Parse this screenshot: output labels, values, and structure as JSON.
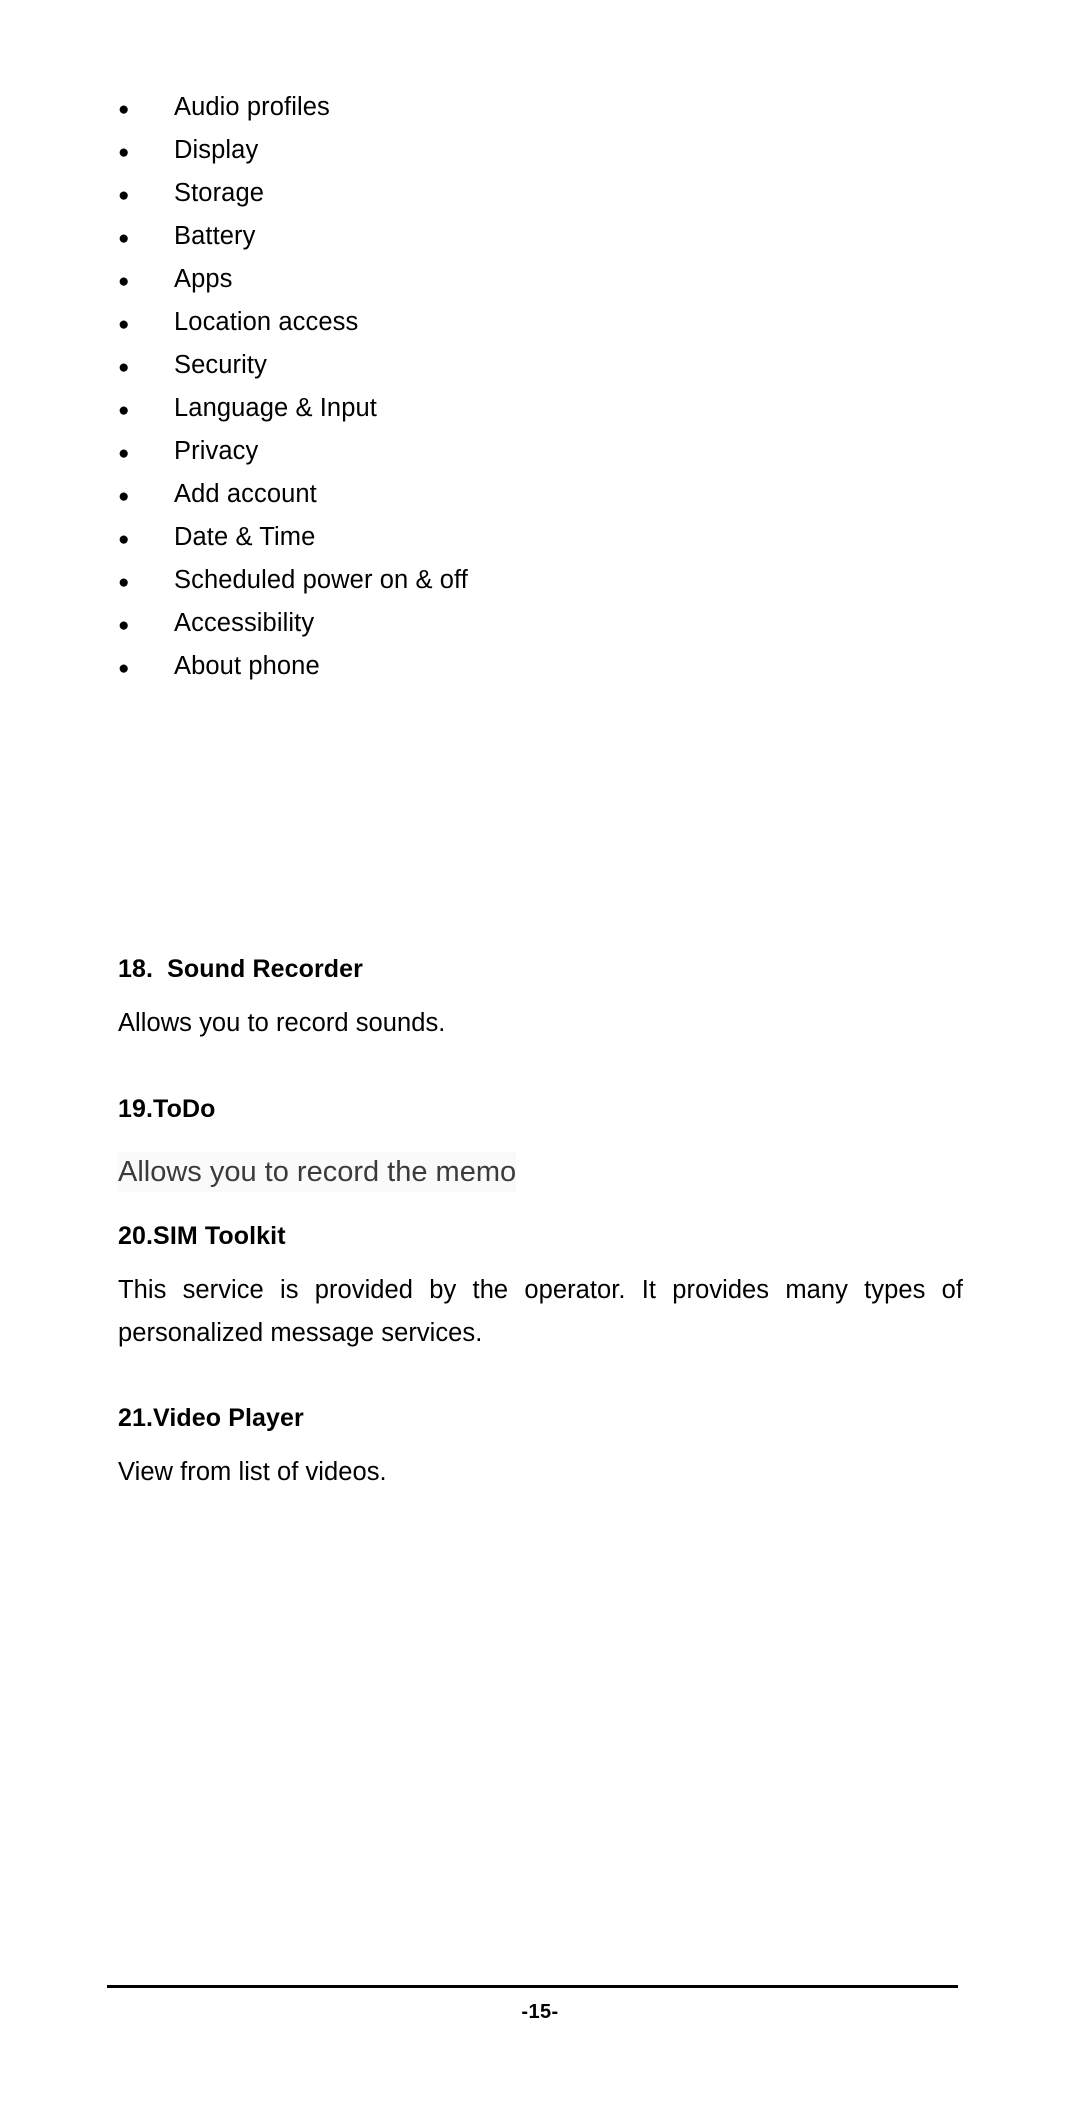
{
  "document": {
    "page_label": "-15-"
  },
  "settings_list": {
    "bullet_glyph": "●",
    "items": [
      {
        "label": "Audio profiles"
      },
      {
        "label": "Display"
      },
      {
        "label": "Storage"
      },
      {
        "label": "Battery"
      },
      {
        "label": "Apps"
      },
      {
        "label": "Location access"
      },
      {
        "label": "Security"
      },
      {
        "label": "Language & Input"
      },
      {
        "label": "Privacy"
      },
      {
        "label": "Add account"
      },
      {
        "label": "Date & Time"
      },
      {
        "label": "Scheduled power on & off"
      },
      {
        "label": "Accessibility"
      },
      {
        "label": "About phone"
      }
    ]
  },
  "sections": [
    {
      "heading": "18.  Sound Recorder",
      "body": "Allows you to record sounds."
    },
    {
      "heading": "19.ToDo",
      "body": "Allows you to record the memo"
    },
    {
      "heading": "20.SIM Toolkit",
      "body": "This service is provided by the operator. It provides many types of personalized message services."
    },
    {
      "heading": "21.Video Player",
      "body": "View from list of videos."
    }
  ]
}
